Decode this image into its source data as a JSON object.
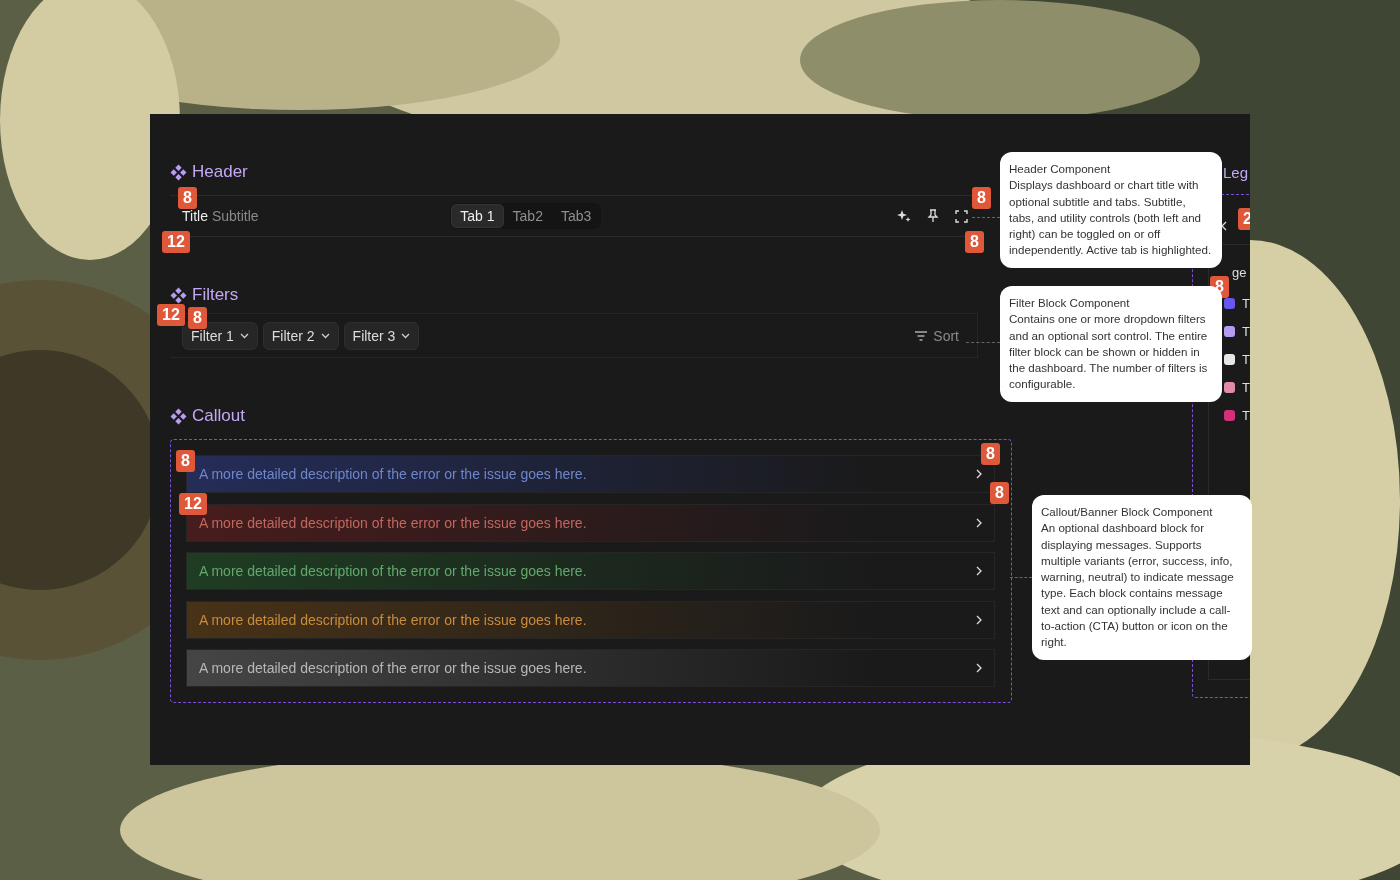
{
  "header_block": {
    "section_title": "Header",
    "title": "Title",
    "subtitle": "Subtitle",
    "tabs": [
      {
        "label": "Tab 1",
        "selected": true
      },
      {
        "label": "Tab2",
        "selected": false
      },
      {
        "label": "Tab3",
        "selected": false
      }
    ]
  },
  "filter_block": {
    "section_title": "Filters",
    "filters": [
      "Filter 1",
      "Filter 2",
      "Filter 3"
    ],
    "sort": "Sort"
  },
  "callout_block": {
    "section_title": "Callout",
    "banners": [
      {
        "kind": "info",
        "text": "A more detailed description of the error or the issue goes here."
      },
      {
        "kind": "error",
        "text": "A more detailed description of the error or the issue goes here."
      },
      {
        "kind": "success",
        "text": "A more detailed description of the error or the issue goes here."
      },
      {
        "kind": "warning",
        "text": "A more detailed description of the error or the issue goes here."
      },
      {
        "kind": "neutral",
        "text": "A more detailed description of the error or the issue goes here."
      }
    ]
  },
  "legend_block": {
    "section_title": "Leg",
    "subtitle": "ge",
    "badge": "2",
    "items": [
      {
        "label": "T",
        "color": "#6655ee"
      },
      {
        "label": "T",
        "color": "#b49cf2"
      },
      {
        "label": "T",
        "color": "#e6e6e6"
      },
      {
        "label": "T",
        "color": "#e08ca8"
      },
      {
        "label": "T",
        "color": "#d4307a"
      }
    ]
  },
  "annotations": [
    {
      "title": "Header Component",
      "body": "Displays dashboard or chart title with optional subtitle and tabs. Subtitle, tabs, and utility controls (both left and right) can be toggled on or off independently. Active tab is highlighted."
    },
    {
      "title": "Filter Block Component",
      "body": "Contains one or more dropdown filters and an optional sort control. The entire filter block can be shown or hidden in the dashboard. The number of filters is configurable."
    },
    {
      "title": "Callout/Banner Block Component",
      "body": "An optional dashboard block for displaying messages. Supports multiple variants (error, success, info, warning, neutral) to indicate message type. Each block contains message text and can optionally include a call-to-action (CTA) button or icon on the right."
    }
  ],
  "spacing_badges": [
    "8",
    "12",
    "8",
    "8",
    "12",
    "8",
    "8",
    "12",
    "8",
    "8",
    "8"
  ]
}
